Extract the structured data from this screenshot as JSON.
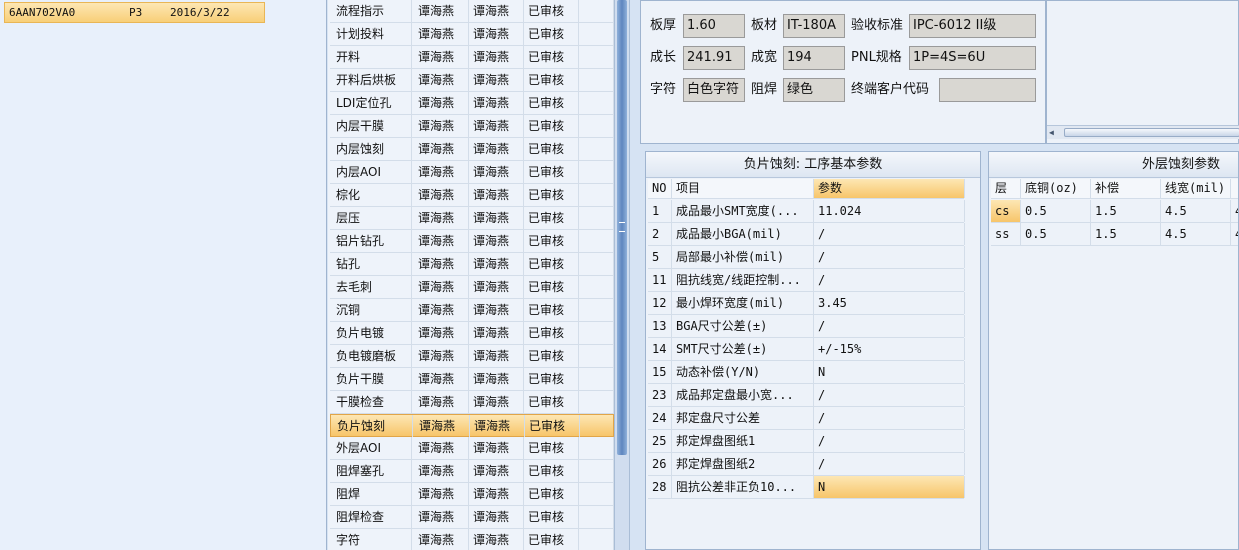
{
  "order_list": {
    "rows": [
      {
        "part_no": "6AAN702VA0",
        "version": "P3",
        "date": "2016/3/22"
      }
    ]
  },
  "process_list": {
    "rows": [
      {
        "name": "流程指示",
        "user1": "谭海燕",
        "user2": "谭海燕",
        "status": "已审核"
      },
      {
        "name": "计划投料",
        "user1": "谭海燕",
        "user2": "谭海燕",
        "status": "已审核"
      },
      {
        "name": "开料",
        "user1": "谭海燕",
        "user2": "谭海燕",
        "status": "已审核"
      },
      {
        "name": "开料后烘板",
        "user1": "谭海燕",
        "user2": "谭海燕",
        "status": "已审核"
      },
      {
        "name": "LDI定位孔",
        "user1": "谭海燕",
        "user2": "谭海燕",
        "status": "已审核"
      },
      {
        "name": "内层干膜",
        "user1": "谭海燕",
        "user2": "谭海燕",
        "status": "已审核"
      },
      {
        "name": "内层蚀刻",
        "user1": "谭海燕",
        "user2": "谭海燕",
        "status": "已审核"
      },
      {
        "name": "内层AOI",
        "user1": "谭海燕",
        "user2": "谭海燕",
        "status": "已审核"
      },
      {
        "name": "棕化",
        "user1": "谭海燕",
        "user2": "谭海燕",
        "status": "已审核"
      },
      {
        "name": "层压",
        "user1": "谭海燕",
        "user2": "谭海燕",
        "status": "已审核"
      },
      {
        "name": "铝片钻孔",
        "user1": "谭海燕",
        "user2": "谭海燕",
        "status": "已审核"
      },
      {
        "name": "钻孔",
        "user1": "谭海燕",
        "user2": "谭海燕",
        "status": "已审核"
      },
      {
        "name": "去毛刺",
        "user1": "谭海燕",
        "user2": "谭海燕",
        "status": "已审核"
      },
      {
        "name": "沉铜",
        "user1": "谭海燕",
        "user2": "谭海燕",
        "status": "已审核"
      },
      {
        "name": "负片电镀",
        "user1": "谭海燕",
        "user2": "谭海燕",
        "status": "已审核"
      },
      {
        "name": "负电镀磨板",
        "user1": "谭海燕",
        "user2": "谭海燕",
        "status": "已审核"
      },
      {
        "name": "负片干膜",
        "user1": "谭海燕",
        "user2": "谭海燕",
        "status": "已审核"
      },
      {
        "name": "干膜检查",
        "user1": "谭海燕",
        "user2": "谭海燕",
        "status": "已审核"
      },
      {
        "name": "负片蚀刻",
        "user1": "谭海燕",
        "user2": "谭海燕",
        "status": "已审核"
      },
      {
        "name": "外层AOI",
        "user1": "谭海燕",
        "user2": "谭海燕",
        "status": "已审核"
      },
      {
        "name": "阻焊塞孔",
        "user1": "谭海燕",
        "user2": "谭海燕",
        "status": "已审核"
      },
      {
        "name": "阻焊",
        "user1": "谭海燕",
        "user2": "谭海燕",
        "status": "已审核"
      },
      {
        "name": "阻焊检查",
        "user1": "谭海燕",
        "user2": "谭海燕",
        "status": "已审核"
      },
      {
        "name": "字符",
        "user1": "谭海燕",
        "user2": "谭海燕",
        "status": "已审核"
      }
    ],
    "selected_index": 18
  },
  "info": {
    "board_thickness_label": "板厚",
    "board_thickness": "1.60",
    "material_label": "板材",
    "material": "IT-180A",
    "standard_label": "验收标准",
    "standard": "IPC-6012 II级",
    "length_label": "成长",
    "length": "241.91",
    "width_label": "成宽",
    "width": "194",
    "pnl_label": "PNL规格",
    "pnl": "1P=4S=6U",
    "silkscreen_label": "字符",
    "silkscreen": "白色字符",
    "soldermask_label": "阻焊",
    "soldermask": "绿色",
    "end_customer_label": "终端客户代码",
    "end_customer": ""
  },
  "negative_etch": {
    "title": "负片蚀刻: 工序基本参数",
    "headers": {
      "no": "NO",
      "item": "项目",
      "param": "参数"
    },
    "rows": [
      {
        "no": "1",
        "item": "成品最小SMT宽度(...",
        "param": "11.024"
      },
      {
        "no": "2",
        "item": "成品最小BGA(mil)",
        "param": "/"
      },
      {
        "no": "5",
        "item": "局部最小补偿(mil)",
        "param": "/"
      },
      {
        "no": "11",
        "item": "阻抗线宽/线距控制...",
        "param": "/"
      },
      {
        "no": "12",
        "item": "最小焊环宽度(mil)",
        "param": "3.45"
      },
      {
        "no": "13",
        "item": "BGA尺寸公差(±)",
        "param": "/"
      },
      {
        "no": "14",
        "item": "SMT尺寸公差(±)",
        "param": "+/-15%"
      },
      {
        "no": "15",
        "item": "动态补偿(Y/N)",
        "param": "N"
      },
      {
        "no": "23",
        "item": "成品邦定盘最小宽...",
        "param": "/"
      },
      {
        "no": "24",
        "item": "邦定盘尺寸公差",
        "param": "/"
      },
      {
        "no": "25",
        "item": "邦定焊盘图纸1",
        "param": "/"
      },
      {
        "no": "26",
        "item": "邦定焊盘图纸2",
        "param": "/"
      },
      {
        "no": "28",
        "item": "阻抗公差非正负10...",
        "param": "N"
      }
    ],
    "selected_index": 12
  },
  "outer_etch": {
    "title": "外层蚀刻参数",
    "headers": {
      "layer": "层",
      "base_copper": "底铜(oz)",
      "comp": "补偿",
      "line_width": "线宽(mil)",
      "extra": ""
    },
    "rows": [
      {
        "layer": "cs",
        "base_copper": "0.5",
        "comp": "1.5",
        "line_width": "4.5",
        "extra": "4"
      },
      {
        "layer": "ss",
        "base_copper": "0.5",
        "comp": "1.5",
        "line_width": "4.5",
        "extra": "4"
      }
    ]
  },
  "colors": {
    "selection": "#f7c56a",
    "panel_border": "#9fb4cf",
    "scrollbar": "#5e86bf"
  }
}
